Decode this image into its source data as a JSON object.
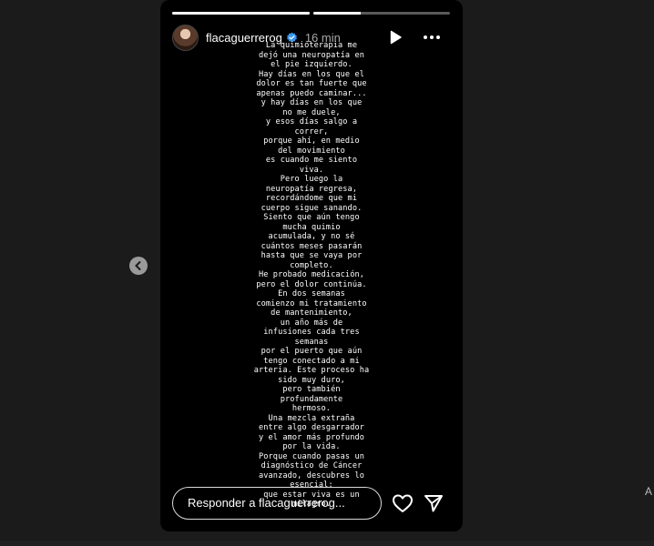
{
  "story": {
    "username": "flacaguerrerog",
    "time_ago": "16 min",
    "progress": [
      1.0,
      0.35
    ],
    "text_lines": [
      "La quimioterapia me",
      "dejó una neuropatía en",
      "el pie izquierdo.",
      "Hay días en los que el",
      "dolor es tan fuerte que",
      "apenas puedo caminar...",
      "y hay días en los que",
      "no me duele,",
      "y esos días salgo a",
      "correr,",
      "porque ahí, en medio",
      "del movimiento",
      "es cuando me siento",
      "viva.",
      "Pero luego la",
      "neuropatía regresa,",
      "recordándome que mi",
      "cuerpo sigue sanando.",
      "Siento que aún tengo",
      "mucha quimio",
      "acumulada, y no sé",
      "cuántos meses pasarán",
      "hasta que se vaya por",
      "completo.",
      "He probado medicación,",
      "pero el dolor continúa.",
      "En dos semanas",
      "comienzo mi tratamiento",
      "de mantenimiento,",
      "un año más de",
      "infusiones cada tres",
      "semanas",
      "por el puerto que aún",
      "tengo conectado a mi",
      "arteria. Este proceso ha",
      "sido muy duro,",
      "pero también",
      "profundamente",
      "hermoso.",
      "Una mezcla extraña",
      "entre algo desgarrador",
      "y el amor más profundo",
      "por la vida.",
      "Porque cuando pasas un",
      "diagnóstico de Cáncer",
      "avanzado, descubres lo",
      "esencial:",
      "que estar viva es un",
      "milagro."
    ],
    "reply_placeholder": "Responder a flacaguerrerog..."
  },
  "edge_text": "A",
  "icons": {
    "verified": "verified-badge-icon",
    "play": "play-icon",
    "more": "more-options-icon",
    "heart": "heart-icon",
    "send": "send-icon",
    "prev": "chevron-left-icon"
  }
}
